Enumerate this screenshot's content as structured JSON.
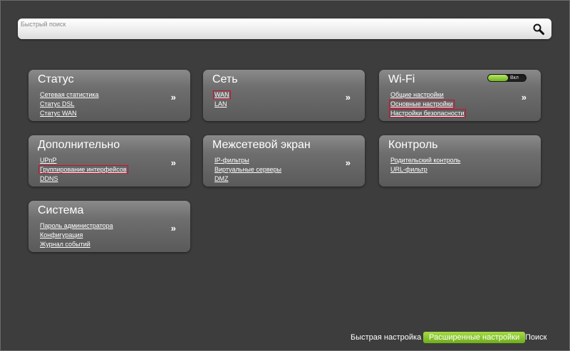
{
  "search": {
    "placeholder": "Быстрый поиск"
  },
  "cards": {
    "status": {
      "title": "Статус",
      "links": [
        "Сетевая статистика",
        "Статус DSL",
        "Статус WAN"
      ],
      "more": "»"
    },
    "network": {
      "title": "Сеть",
      "links": [
        "WAN",
        "LAN"
      ],
      "more": "»"
    },
    "wifi": {
      "title": "Wi-Fi",
      "toggle_label": "Вкл",
      "links": [
        "Общие настройки",
        "Основные настройки",
        "Настройки безопасности"
      ],
      "more": "»"
    },
    "advanced": {
      "title": "Дополнительно",
      "links": [
        "UPnP",
        "Группирование интерфейсов",
        "DDNS"
      ],
      "more": "»"
    },
    "firewall": {
      "title": "Межсетевой экран",
      "links": [
        "IP-фильтры",
        "Виртуальные серверы",
        "DMZ"
      ],
      "more": "»"
    },
    "control": {
      "title": "Контроль",
      "links": [
        "Родительский контроль",
        "URL-фильтр"
      ]
    },
    "system": {
      "title": "Система",
      "links": [
        "Пароль администратора",
        "Конфигурация",
        "Журнал событий"
      ],
      "more": "»"
    }
  },
  "bottom_nav": {
    "quick_setup": "Быстрая настройка",
    "advanced_settings": "Расширенные настройки",
    "search": "Поиск"
  },
  "colors": {
    "accent_green": "#8cc63f",
    "highlight_red": "#c8102e",
    "background": "#3d3d3d"
  }
}
